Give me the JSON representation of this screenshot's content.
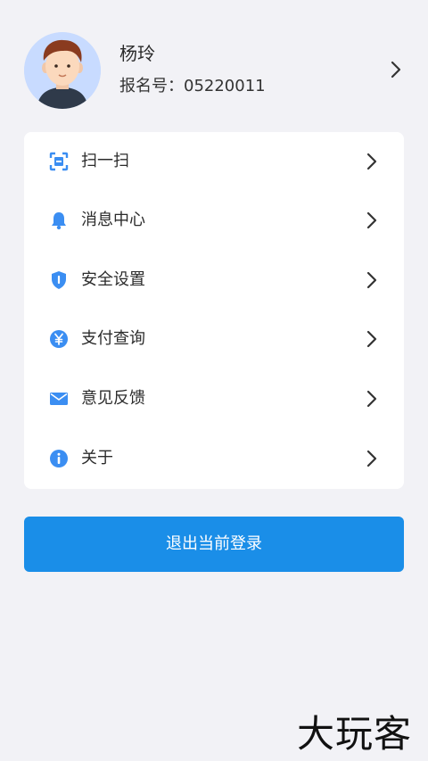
{
  "profile": {
    "name": "杨玲",
    "id_label": "报名号：05220011"
  },
  "menu": {
    "items": [
      {
        "label": "扫一扫",
        "icon": "scan-icon"
      },
      {
        "label": "消息中心",
        "icon": "bell-icon"
      },
      {
        "label": "安全设置",
        "icon": "shield-icon"
      },
      {
        "label": "支付查询",
        "icon": "yen-icon"
      },
      {
        "label": "意见反馈",
        "icon": "mail-icon"
      },
      {
        "label": "关于",
        "icon": "info-icon"
      }
    ]
  },
  "logout": {
    "label": "退出当前登录"
  },
  "watermark": {
    "text": "大玩客"
  },
  "colors": {
    "accent": "#1a8ee8",
    "icon_blue": "#3b8ef2",
    "background": "#f2f2f6"
  }
}
